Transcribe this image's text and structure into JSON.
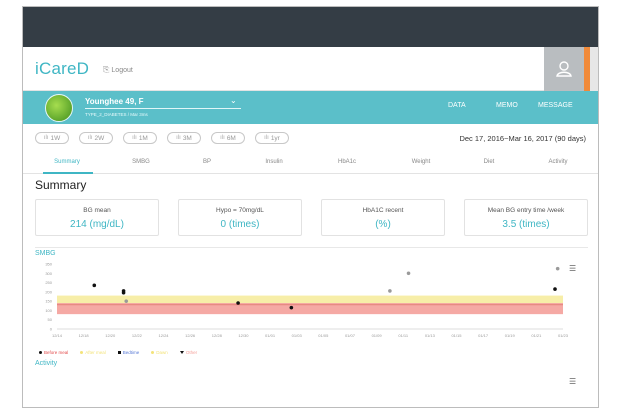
{
  "app": {
    "title": "iCareD",
    "logout_label": "Logout",
    "accent": "#3fb6c4"
  },
  "user": {
    "name": "Younghee 49, F",
    "diagnosis": "TYPE_2_DIABETES / Mar 3ms"
  },
  "topnav": [
    {
      "label": "DATA"
    },
    {
      "label": "MEMO"
    },
    {
      "label": "MESSAGE"
    }
  ],
  "periods": [
    {
      "label": "1W"
    },
    {
      "label": "2W"
    },
    {
      "label": "1M"
    },
    {
      "label": "3M"
    },
    {
      "label": "6M"
    },
    {
      "label": "1yr"
    }
  ],
  "date_range": "Dec 17, 2016~Mar 16, 2017 (90 days)",
  "tabs": [
    {
      "label": "Summary",
      "active": true
    },
    {
      "label": "SMBG"
    },
    {
      "label": "BP"
    },
    {
      "label": "Insulin"
    },
    {
      "label": "HbA1c"
    },
    {
      "label": "Weight"
    },
    {
      "label": "Diet"
    },
    {
      "label": "Activity"
    }
  ],
  "summary": {
    "title": "Summary",
    "cards": [
      {
        "label": "BG mean",
        "value": "214 (mg/dL)"
      },
      {
        "label": "Hypo = 70mg/dL",
        "value": "0 (times)"
      },
      {
        "label": "HbA1C recent",
        "value": "(%)"
      },
      {
        "label": "Mean BG entry time /week",
        "value": "3.5 (times)"
      }
    ]
  },
  "smbg_title": "SMBG",
  "activity_title": "Activity",
  "chart_data": {
    "type": "scatter",
    "title": "",
    "xlabel": "",
    "ylabel": "",
    "ylim": [
      0,
      350
    ],
    "y_ticks": [
      "350",
      "300",
      "250",
      "200",
      "150",
      "100",
      "50",
      "0"
    ],
    "x_ticks": [
      "12/14",
      "12/18",
      "12/20",
      "12/22",
      "12/24",
      "12/26",
      "12/28",
      "12/30",
      "01/01",
      "01/03",
      "01/05",
      "01/07",
      "01/09",
      "01/11",
      "01/13",
      "01/15",
      "01/17",
      "01/19",
      "01/21",
      "01/23"
    ],
    "bands": [
      {
        "from": 80,
        "to": 140,
        "color": "#f4a09a"
      },
      {
        "from": 140,
        "to": 180,
        "color": "#f6ec9e"
      }
    ],
    "target_line": 130,
    "series": [
      {
        "name": "Before meal",
        "color": "#111111",
        "points": [
          {
            "x": 1.4,
            "y": 235
          },
          {
            "x": 2.5,
            "y": 205
          },
          {
            "x": 2.5,
            "y": 195
          },
          {
            "x": 6.8,
            "y": 140
          },
          {
            "x": 8.8,
            "y": 115
          },
          {
            "x": 18.7,
            "y": 215
          }
        ]
      },
      {
        "name": "After meal",
        "color": "#f3e37a",
        "points": []
      },
      {
        "name": "Bedtime",
        "color": "#111111",
        "points": []
      },
      {
        "name": "Dawn",
        "color": "#9a9a9a",
        "points": [
          {
            "x": 2.6,
            "y": 150
          },
          {
            "x": 12.5,
            "y": 205
          },
          {
            "x": 13.2,
            "y": 300
          },
          {
            "x": 18.8,
            "y": 325
          }
        ]
      },
      {
        "name": "Other",
        "color": "#111111",
        "points": []
      }
    ]
  },
  "legend": [
    {
      "label": "Before meal",
      "color": "#e24c4c",
      "marker": "dot",
      "marker_color": "#111111"
    },
    {
      "label": "After meal",
      "color": "#f3e37a",
      "marker": "dot",
      "marker_color": "#f3e37a"
    },
    {
      "label": "Bedtime",
      "color": "#5a7bd6",
      "marker": "square",
      "marker_color": "#111111"
    },
    {
      "label": "Dawn",
      "color": "#f3e37a",
      "marker": "dot",
      "marker_color": "#f3e37a"
    },
    {
      "label": "Other",
      "color": "#f4a09a",
      "marker": "tri",
      "marker_color": "#111111"
    }
  ]
}
